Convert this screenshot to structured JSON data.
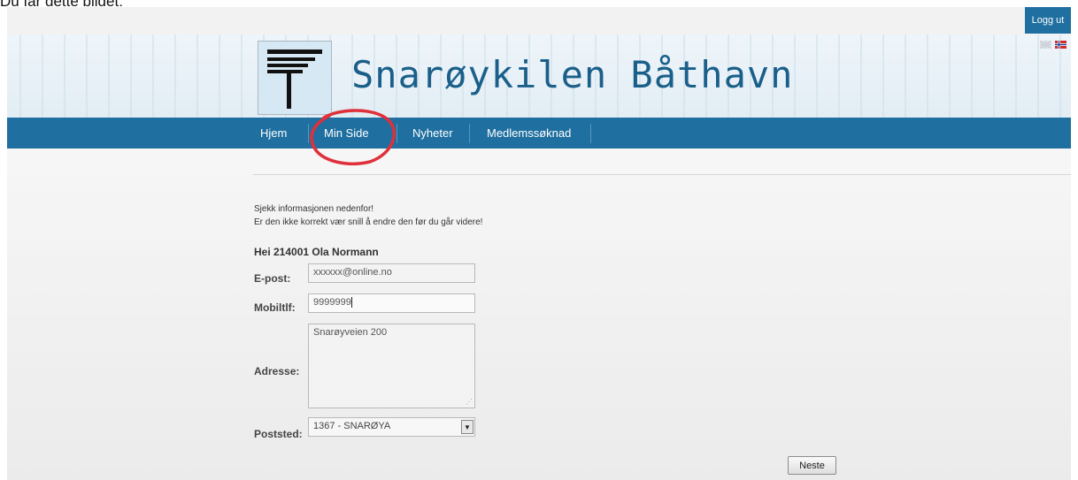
{
  "caption": "Du får dette bildet:",
  "topbar": {
    "logout_label": "Logg ut"
  },
  "languages": [
    {
      "name": "english-flag-icon"
    },
    {
      "name": "norwegian-flag-icon"
    }
  ],
  "site": {
    "title": "Snarøykilen Båthavn"
  },
  "nav": [
    {
      "label": "Hjem"
    },
    {
      "label": "Min Side"
    },
    {
      "label": "Nyheter"
    },
    {
      "label": "Medlemssøknad"
    }
  ],
  "info": {
    "line1": "Sjekk informasjonen nedenfor!",
    "line2": "Er den ikke korrekt vær snill å endre den før du går videre!"
  },
  "greeting": "Hei 214001 Ola Normann",
  "form": {
    "email_label": "E-post:",
    "email_value": "xxxxxx@online.no",
    "mobile_label": "Mobiltlf:",
    "mobile_value": "9999999",
    "address_label": "Adresse:",
    "address_value": "Snarøyveien 200",
    "postal_label": "Poststed:",
    "postal_value": "1367 - SNARØYA"
  },
  "next_label": "Neste",
  "colors": {
    "nav": "#1f6fa0",
    "title": "#1a5f8a",
    "annotation": "#e0303a"
  }
}
